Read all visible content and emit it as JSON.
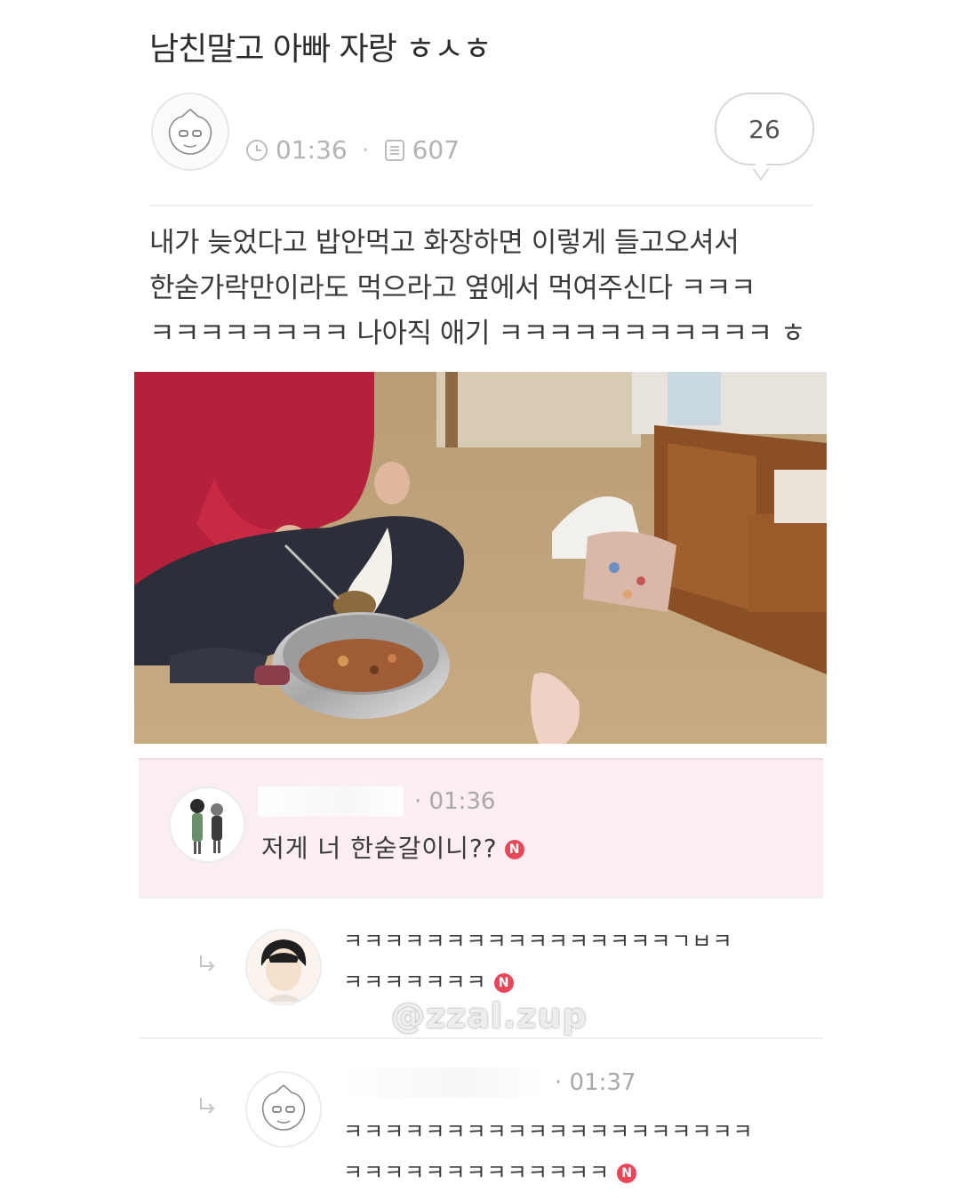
{
  "post": {
    "title": "남친말고 아빠 자랑 ㅎㅅㅎ",
    "time": "01:36",
    "views": "607",
    "comment_count": "26",
    "body_lines": [
      "내가 늦었다고 밥안먹고 화장하면 이렇게 들고오셔서",
      "한숟가락만이라도 먹으라고 옆에서 먹여주신다 ㅋㅋㅋ",
      "ㅋㅋㅋㅋㅋㅋㅋㅋ 나아직 애기 ㅋㅋㅋㅋㅋㅋㅋㅋㅋㅋㅋ ㅎ"
    ]
  },
  "comments": [
    {
      "time": "01:36",
      "text": "저게 너 한숟갈이니??",
      "badge": "N"
    },
    {
      "text_line1": "ㅋㅋㅋㅋㅋㅋㅋㅋㅋㅋㅋㅋㅋㅋㅋㅋㄱㅂㅋ",
      "text_line2": "ㅋㅋㅋㅋㅋㅋㅋ",
      "badge": "N"
    },
    {
      "time": "01:37",
      "text_line1": "ㅋㅋㅋㅋㅋㅋㅋㅋㅋㅋㅋㅋㅋㅋㅋㅋㅋㅋㅋㅋ",
      "text_line2": "ㅋㅋㅋㅋㅋㅋㅋㅋㅋㅋㅋㅋㅋ",
      "badge": "N"
    }
  ],
  "watermark": "@zzal.zup",
  "colors": {
    "badge": "#e8475a",
    "highlight_comment_bg": "#fbeef0",
    "meta_gray": "#b3b3b3"
  }
}
